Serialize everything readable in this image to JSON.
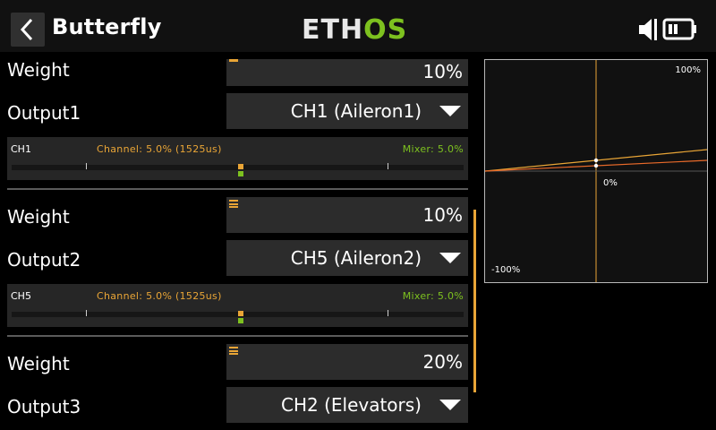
{
  "header": {
    "title": "Butterfly",
    "logo_part1": "ETH",
    "logo_part2": "OS"
  },
  "blocks": [
    {
      "weight_label": "Weight",
      "weight_value": "10%",
      "output_label": "Output1",
      "output_value": "CH1 (Aileron1)",
      "monitor": {
        "channel": "CH1",
        "channel_value": "Channel: 5.0% (1525us)",
        "mixer_value": "Mixer: 5.0%"
      }
    },
    {
      "weight_label": "Weight",
      "weight_value": "10%",
      "output_label": "Output2",
      "output_value": "CH5 (Aileron2)",
      "monitor": {
        "channel": "CH5",
        "channel_value": "Channel: 5.0% (1525us)",
        "mixer_value": "Mixer: 5.0%"
      }
    },
    {
      "weight_label": "Weight",
      "weight_value": "20%",
      "output_label": "Output3",
      "output_value": "CH2 (Elevators)"
    }
  ],
  "graph": {
    "label_top": "100%",
    "label_center": "0%",
    "label_bottom": "-100%"
  },
  "colors": {
    "accent": "#e9a536",
    "green": "#7dc11f",
    "field": "#2c2c2c"
  }
}
